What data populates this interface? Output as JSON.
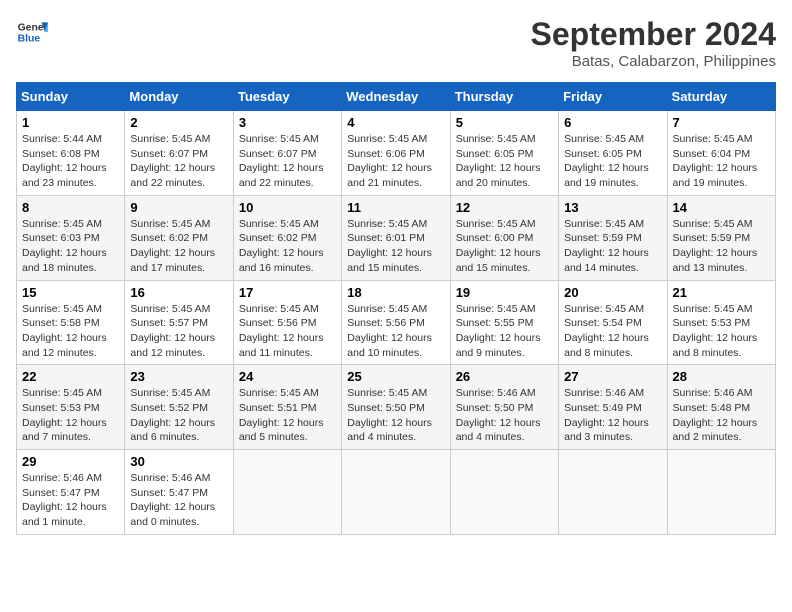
{
  "header": {
    "logo_line1": "General",
    "logo_line2": "Blue",
    "title": "September 2024",
    "subtitle": "Batas, Calabarzon, Philippines"
  },
  "weekdays": [
    "Sunday",
    "Monday",
    "Tuesday",
    "Wednesday",
    "Thursday",
    "Friday",
    "Saturday"
  ],
  "weeks": [
    [
      {
        "day": "1",
        "info": "Sunrise: 5:44 AM\nSunset: 6:08 PM\nDaylight: 12 hours\nand 23 minutes."
      },
      {
        "day": "2",
        "info": "Sunrise: 5:45 AM\nSunset: 6:07 PM\nDaylight: 12 hours\nand 22 minutes."
      },
      {
        "day": "3",
        "info": "Sunrise: 5:45 AM\nSunset: 6:07 PM\nDaylight: 12 hours\nand 22 minutes."
      },
      {
        "day": "4",
        "info": "Sunrise: 5:45 AM\nSunset: 6:06 PM\nDaylight: 12 hours\nand 21 minutes."
      },
      {
        "day": "5",
        "info": "Sunrise: 5:45 AM\nSunset: 6:05 PM\nDaylight: 12 hours\nand 20 minutes."
      },
      {
        "day": "6",
        "info": "Sunrise: 5:45 AM\nSunset: 6:05 PM\nDaylight: 12 hours\nand 19 minutes."
      },
      {
        "day": "7",
        "info": "Sunrise: 5:45 AM\nSunset: 6:04 PM\nDaylight: 12 hours\nand 19 minutes."
      }
    ],
    [
      {
        "day": "8",
        "info": "Sunrise: 5:45 AM\nSunset: 6:03 PM\nDaylight: 12 hours\nand 18 minutes."
      },
      {
        "day": "9",
        "info": "Sunrise: 5:45 AM\nSunset: 6:02 PM\nDaylight: 12 hours\nand 17 minutes."
      },
      {
        "day": "10",
        "info": "Sunrise: 5:45 AM\nSunset: 6:02 PM\nDaylight: 12 hours\nand 16 minutes."
      },
      {
        "day": "11",
        "info": "Sunrise: 5:45 AM\nSunset: 6:01 PM\nDaylight: 12 hours\nand 15 minutes."
      },
      {
        "day": "12",
        "info": "Sunrise: 5:45 AM\nSunset: 6:00 PM\nDaylight: 12 hours\nand 15 minutes."
      },
      {
        "day": "13",
        "info": "Sunrise: 5:45 AM\nSunset: 5:59 PM\nDaylight: 12 hours\nand 14 minutes."
      },
      {
        "day": "14",
        "info": "Sunrise: 5:45 AM\nSunset: 5:59 PM\nDaylight: 12 hours\nand 13 minutes."
      }
    ],
    [
      {
        "day": "15",
        "info": "Sunrise: 5:45 AM\nSunset: 5:58 PM\nDaylight: 12 hours\nand 12 minutes."
      },
      {
        "day": "16",
        "info": "Sunrise: 5:45 AM\nSunset: 5:57 PM\nDaylight: 12 hours\nand 12 minutes."
      },
      {
        "day": "17",
        "info": "Sunrise: 5:45 AM\nSunset: 5:56 PM\nDaylight: 12 hours\nand 11 minutes."
      },
      {
        "day": "18",
        "info": "Sunrise: 5:45 AM\nSunset: 5:56 PM\nDaylight: 12 hours\nand 10 minutes."
      },
      {
        "day": "19",
        "info": "Sunrise: 5:45 AM\nSunset: 5:55 PM\nDaylight: 12 hours\nand 9 minutes."
      },
      {
        "day": "20",
        "info": "Sunrise: 5:45 AM\nSunset: 5:54 PM\nDaylight: 12 hours\nand 8 minutes."
      },
      {
        "day": "21",
        "info": "Sunrise: 5:45 AM\nSunset: 5:53 PM\nDaylight: 12 hours\nand 8 minutes."
      }
    ],
    [
      {
        "day": "22",
        "info": "Sunrise: 5:45 AM\nSunset: 5:53 PM\nDaylight: 12 hours\nand 7 minutes."
      },
      {
        "day": "23",
        "info": "Sunrise: 5:45 AM\nSunset: 5:52 PM\nDaylight: 12 hours\nand 6 minutes."
      },
      {
        "day": "24",
        "info": "Sunrise: 5:45 AM\nSunset: 5:51 PM\nDaylight: 12 hours\nand 5 minutes."
      },
      {
        "day": "25",
        "info": "Sunrise: 5:45 AM\nSunset: 5:50 PM\nDaylight: 12 hours\nand 4 minutes."
      },
      {
        "day": "26",
        "info": "Sunrise: 5:46 AM\nSunset: 5:50 PM\nDaylight: 12 hours\nand 4 minutes."
      },
      {
        "day": "27",
        "info": "Sunrise: 5:46 AM\nSunset: 5:49 PM\nDaylight: 12 hours\nand 3 minutes."
      },
      {
        "day": "28",
        "info": "Sunrise: 5:46 AM\nSunset: 5:48 PM\nDaylight: 12 hours\nand 2 minutes."
      }
    ],
    [
      {
        "day": "29",
        "info": "Sunrise: 5:46 AM\nSunset: 5:47 PM\nDaylight: 12 hours\nand 1 minute."
      },
      {
        "day": "30",
        "info": "Sunrise: 5:46 AM\nSunset: 5:47 PM\nDaylight: 12 hours\nand 0 minutes."
      },
      {
        "day": "",
        "info": ""
      },
      {
        "day": "",
        "info": ""
      },
      {
        "day": "",
        "info": ""
      },
      {
        "day": "",
        "info": ""
      },
      {
        "day": "",
        "info": ""
      }
    ]
  ]
}
